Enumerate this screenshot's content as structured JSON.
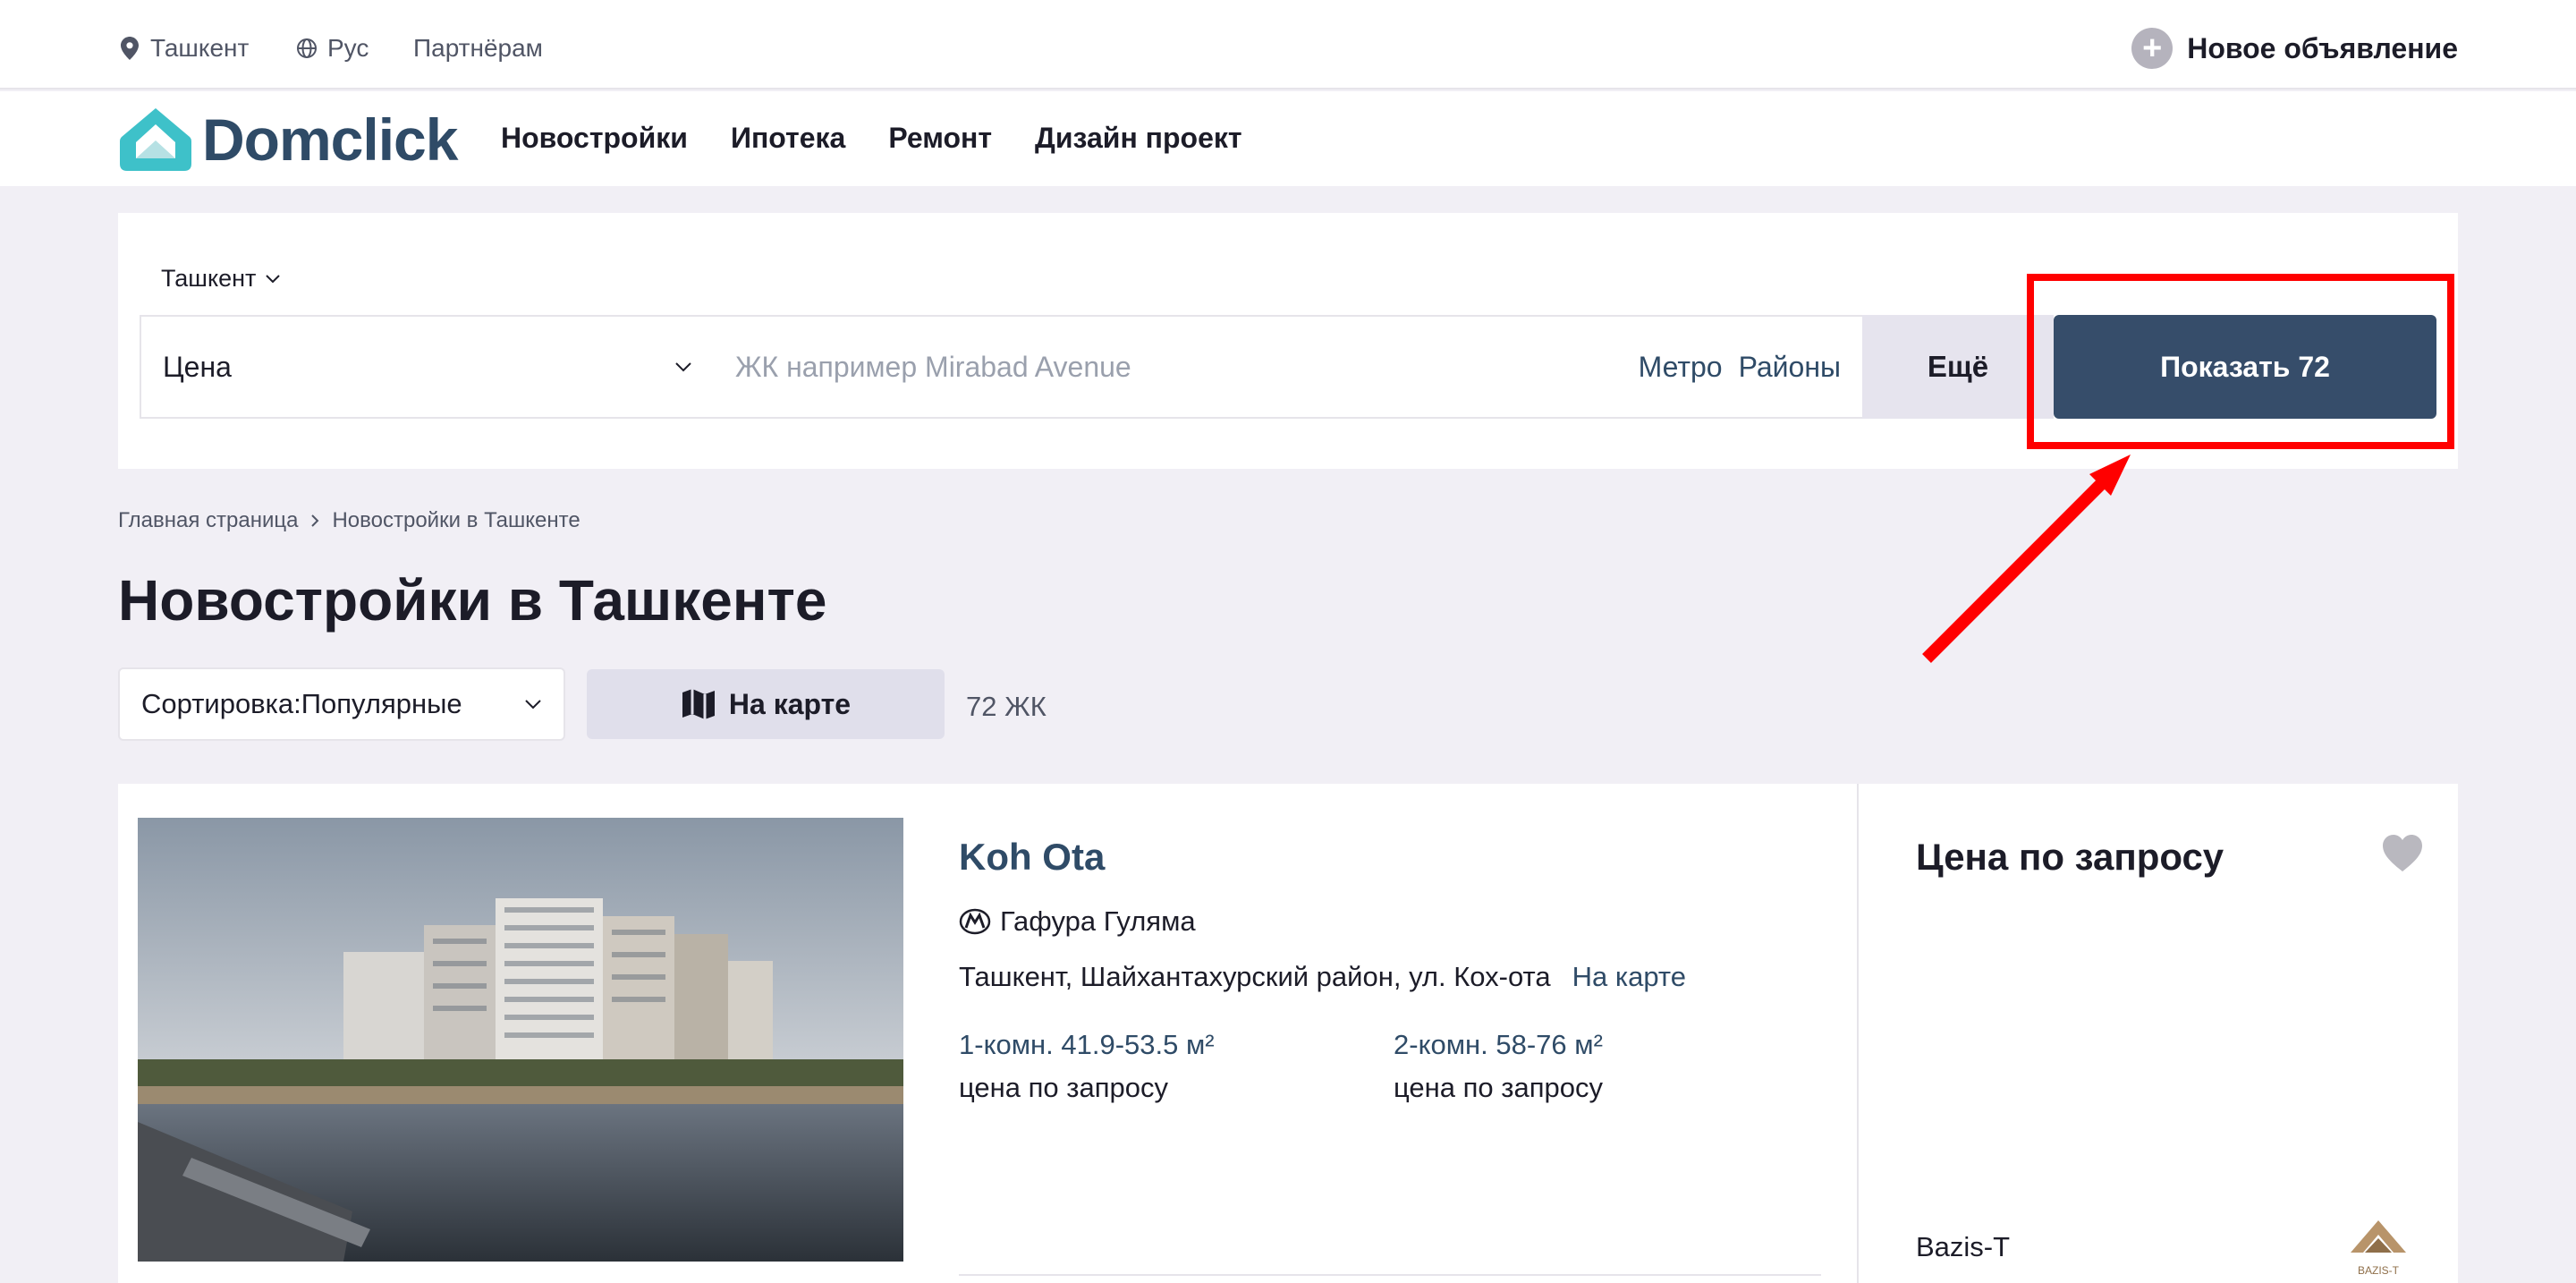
{
  "topbar": {
    "city": "Ташкент",
    "language": "Рус",
    "partners": "Партнёрам",
    "new_ad": "Новое объявление"
  },
  "nav": {
    "logo": "Domclick",
    "links": [
      "Новостройки",
      "Ипотека",
      "Ремонт",
      "Дизайн проект"
    ]
  },
  "search": {
    "city": "Ташкент",
    "price_label": "Цена",
    "name_placeholder": "ЖК например Mirabad Avenue",
    "metro": "Метро",
    "districts": "Районы",
    "more": "Ещё",
    "show_button": "Показать 72"
  },
  "breadcrumb": {
    "home": "Главная страница",
    "current": "Новостройки в Ташкенте"
  },
  "page_title": "Новостройки в Ташкенте",
  "controls": {
    "sort_label": "Сортировка:",
    "sort_value": "Популярные",
    "map_button": "На карте",
    "count": "72 ЖК"
  },
  "listing": {
    "title": "Koh Ota",
    "metro_station": "Гафура Гуляма",
    "address": "Ташкент, Шайхантахурский район, ул. Кох-ота",
    "map_link": "На карте",
    "apartments": [
      {
        "size": "1-комн. 41.9-53.5 м²",
        "price": "цена по запросу"
      },
      {
        "size": "2-комн. 58-76 м²",
        "price": "цена по запросу"
      }
    ],
    "price": "Цена по запросу",
    "developer": "Bazis-T",
    "developer_logo_text": "BAZIS-T"
  },
  "colors": {
    "brand": "#364d6a",
    "logo_accent": "#3ec1c9",
    "highlight": "#ff0000"
  }
}
